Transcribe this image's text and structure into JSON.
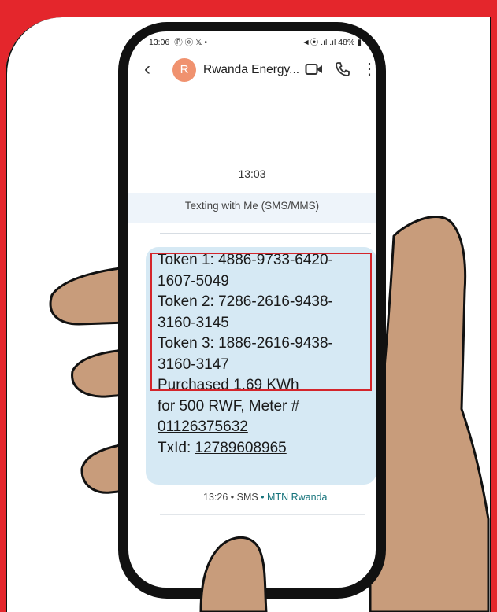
{
  "status_bar": {
    "time": "13:06",
    "left_icons": "Ⓟ ⓞ 𝕏 •",
    "right_text": "48%"
  },
  "conversation": {
    "back_icon": "chevron-left-icon",
    "avatar_letter": "R",
    "contact_name": "Rwanda Energy...",
    "actions": [
      "video-call-icon",
      "phone-icon",
      "more-vert-icon"
    ]
  },
  "thread": {
    "timestamp": "13:03",
    "info_text": "Texting with Me (SMS/MMS)"
  },
  "message": {
    "lines": [
      "Token 1: 4886-9733-6420-",
      "1607-5049",
      "Token 2: 7286-2616-9438-",
      "3160-3145",
      "Token 3: 1886-2616-9438-",
      "3160-3147",
      "Purchased 1.69 KWh",
      "for 500 RWF, Meter #"
    ],
    "meter_number": "01126375632",
    "txid_label": "TxId: ",
    "txid_value": "12789608965",
    "time": "13:26",
    "separator": " • ",
    "type": "SMS",
    "sim": "MTN Rwanda"
  },
  "colors": {
    "frame": "#e4262c",
    "skin": "#c89c7b",
    "bubble": "#d6e9f4",
    "highlight": "#d4252b",
    "avatar": "#f0926f",
    "sim_label": "#15737b"
  }
}
